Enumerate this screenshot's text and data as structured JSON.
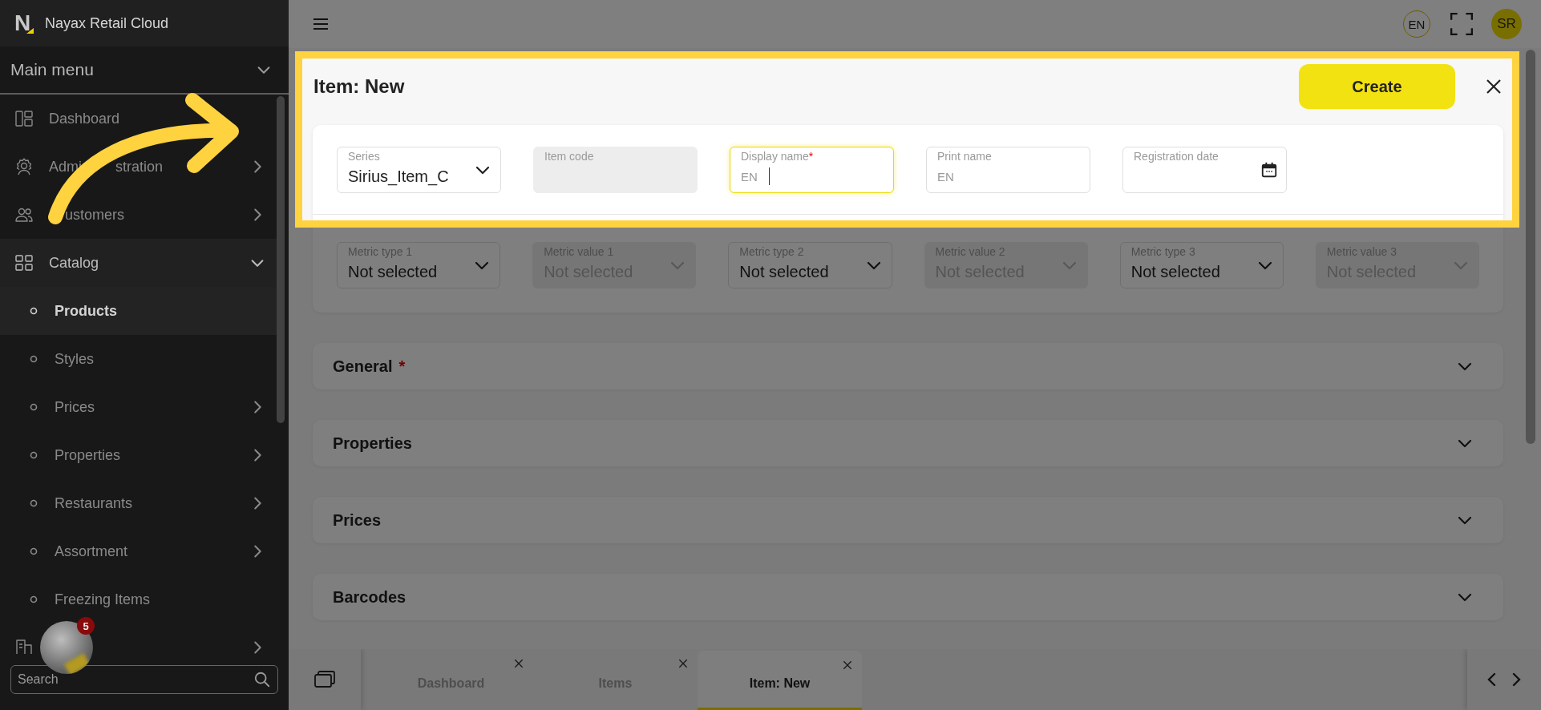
{
  "sidebar": {
    "logo_letter": "N",
    "brand": "Nayax Retail Cloud",
    "menu_title": "Main menu",
    "items": [
      {
        "kind": "link",
        "label": "Dashboard",
        "selected": false
      },
      {
        "kind": "group",
        "label": "Admi",
        "label_rest": "stration",
        "selected": false,
        "expanded": false
      },
      {
        "kind": "group",
        "label": "ustomers",
        "occluded": true,
        "selected": false,
        "expanded": false
      },
      {
        "kind": "group",
        "label": "Catalog",
        "selected": false,
        "expanded": true,
        "children": [
          {
            "kind": "link",
            "label": "Products",
            "selected": true
          },
          {
            "kind": "link",
            "label": "Styles",
            "selected": false
          },
          {
            "kind": "group",
            "label": "Prices",
            "selected": false,
            "expanded": false
          },
          {
            "kind": "group",
            "label": "Properties",
            "selected": false,
            "expanded": false
          },
          {
            "kind": "group",
            "label": "Restaurants",
            "selected": false,
            "expanded": false
          },
          {
            "kind": "group",
            "label": "Assortment",
            "selected": false,
            "expanded": false
          },
          {
            "kind": "link",
            "label": "Freezing Items",
            "selected": false
          }
        ]
      },
      {
        "kind": "group",
        "selected": false,
        "expanded": false
      }
    ],
    "search": {
      "placeholder": "Search"
    },
    "chat": {
      "badge": "5"
    }
  },
  "header": {
    "language": "EN",
    "user_initials": "SR"
  },
  "form": {
    "title": "Item: New",
    "create_button": "Create",
    "fields": [
      {
        "kind": "select",
        "label": "Series",
        "value": "Sirius_Item_C",
        "disabled": false,
        "focused": false
      },
      {
        "kind": "text",
        "label": "Item code",
        "disabled": true,
        "focused": false
      },
      {
        "kind": "text",
        "label": "Display name",
        "required_mark": "*",
        "prefix": "EN",
        "disabled": false,
        "focused": true
      },
      {
        "kind": "text",
        "label": "Print name",
        "prefix": "EN",
        "disabled": false,
        "focused": false
      },
      {
        "kind": "date",
        "label": "Registration date",
        "disabled": false,
        "focused": false
      }
    ],
    "metric_fields": [
      {
        "kind": "select",
        "label": "Metric type 1",
        "value": "Not selected",
        "disabled": false,
        "focused": false
      },
      {
        "kind": "select",
        "label": "Metric value 1",
        "value": "Not selected",
        "disabled": true,
        "focused": false
      },
      {
        "kind": "select",
        "label": "Metric type 2",
        "value": "Not selected",
        "disabled": false,
        "focused": false
      },
      {
        "kind": "select",
        "label": "Metric value 2",
        "value": "Not selected",
        "disabled": true,
        "focused": false
      },
      {
        "kind": "select",
        "label": "Metric type 3",
        "value": "Not selected",
        "disabled": false,
        "focused": false
      },
      {
        "kind": "select",
        "label": "Metric value 3",
        "value": "Not selected",
        "disabled": true,
        "focused": false
      }
    ]
  },
  "sections": [
    {
      "title": "General",
      "required_mark": "*"
    },
    {
      "title": "Properties"
    },
    {
      "title": "Prices"
    },
    {
      "title": "Barcodes"
    }
  ],
  "tabs": [
    {
      "label": "Dashboard",
      "selected": false
    },
    {
      "label": "Items",
      "selected": false
    },
    {
      "label": "Item: New",
      "selected": true
    }
  ]
}
